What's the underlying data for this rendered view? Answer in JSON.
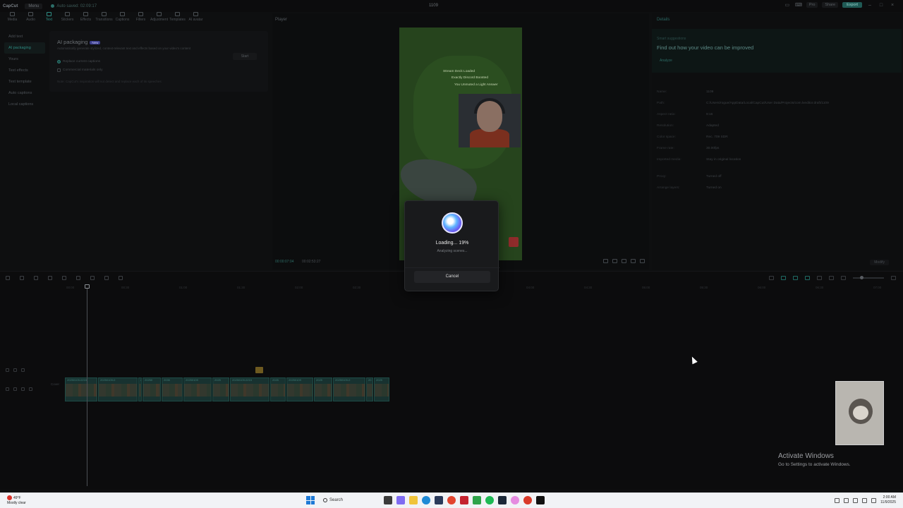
{
  "titlebar": {
    "logo": "CapCut",
    "menu": "Menu",
    "autosave": "Auto saved: 02:09:17",
    "project_title": "1109",
    "pro": "Pro",
    "share": "Share",
    "export": "Export"
  },
  "toolbar": {
    "tools": [
      "Media",
      "Audio",
      "Text",
      "Stickers",
      "Effects",
      "Transitions",
      "Captions",
      "Filters",
      "Adjustment",
      "Templates",
      "AI avatar"
    ]
  },
  "sidebar": {
    "items": [
      "Add text",
      "AI packaging",
      "Yours",
      "Text effects",
      "Text template",
      "Auto captions",
      "Local captions"
    ]
  },
  "text_panel": {
    "title": "AI packaging",
    "badge": "New",
    "description": "Automatically generate stylized, context-relevant text and effects based on your video's content",
    "start": "Start",
    "option1": "Replace current captions",
    "option2": "Commercial materials only",
    "note": "Note: CapCut's inspiration will not detect and replace each of its speeches"
  },
  "player": {
    "title": "Player",
    "current_time": "00:00:07:04",
    "total_time": "00:02:53:27",
    "chat": [
      "Stream Deck Loaded",
      "Exactly Discord Boosted",
      "You Unmuted a Light Answer"
    ]
  },
  "details": {
    "title": "Details",
    "smart_label": "Smart suggestions",
    "headline": "Find out how your video can be improved",
    "analyze": "Analyze",
    "rows": [
      {
        "k": "Name:",
        "v": "1109"
      },
      {
        "k": "Path:",
        "v": "C:/Users/rogue/AppData/Local/CapCut/User Data/Projects/com.lveditor.draft/1109"
      },
      {
        "k": "Aspect ratio:",
        "v": "9:16"
      },
      {
        "k": "Resolution:",
        "v": "Adapted"
      },
      {
        "k": "Color space:",
        "v": "Rec. 709 SDR"
      },
      {
        "k": "Frame rate:",
        "v": "30.00fps"
      },
      {
        "k": "Imported media:",
        "v": "Stay in original location"
      },
      {
        "k": "Proxy:",
        "v": "Turned off"
      },
      {
        "k": "Arrange layers:",
        "v": "Turned on"
      }
    ],
    "modify": "Modify"
  },
  "timeline": {
    "ticks": [
      "00:00",
      "00:30",
      "01:00",
      "01:30",
      "02:00",
      "02:30",
      "03:00",
      "03:30",
      "04:00",
      "04:30",
      "05:00",
      "05:30",
      "06:00",
      "06:30",
      "07:00",
      "07:30"
    ],
    "cover_label": "Cover",
    "clips": [
      {
        "label": "20250109-0215",
        "w": 46
      },
      {
        "label": "20250109-0",
        "w": 56
      },
      {
        "label": "20",
        "w": 5
      },
      {
        "label": "20250",
        "w": 26
      },
      {
        "label": "2035",
        "w": 30
      },
      {
        "label": "20250109",
        "w": 40
      },
      {
        "label": "2025",
        "w": 24
      },
      {
        "label": "20250109-0215",
        "w": 56
      },
      {
        "label": "2025",
        "w": 22
      },
      {
        "label": "20250109",
        "w": 38
      },
      {
        "label": "2025",
        "w": 26
      },
      {
        "label": "20250109-0",
        "w": 46
      },
      {
        "label": "20",
        "w": 10
      },
      {
        "label": "2025",
        "w": 22
      }
    ]
  },
  "modal": {
    "loading": "Loading... 19%",
    "sub": "Analyzing scenes...",
    "cancel": "Cancel"
  },
  "activate": {
    "line1": "Activate Windows",
    "line2": "Go to Settings to activate Windows."
  },
  "taskbar": {
    "temp": "49°F",
    "weather": "Mostly clear",
    "search": "Search",
    "time": "2:00 AM",
    "date": "11/9/2025"
  },
  "colors": {
    "accent": "#2e8c83",
    "export": "#1f5a55",
    "modal_bg": "#191a1c"
  }
}
